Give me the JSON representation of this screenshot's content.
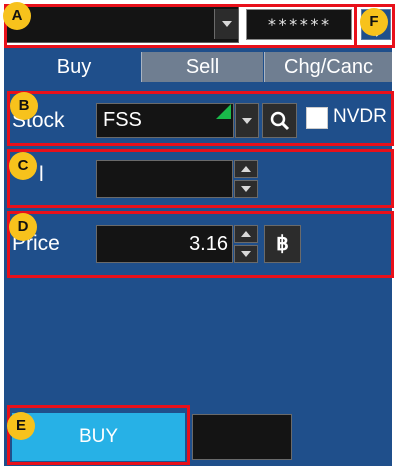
{
  "top_bar": {
    "password_mask": "******"
  },
  "tabs": [
    {
      "label": "Buy"
    },
    {
      "label": "Sell"
    },
    {
      "label": "Chg/Canc"
    }
  ],
  "form": {
    "stock_label": "Stock",
    "stock_value": "FSS",
    "nvdr_label": "NVDR",
    "volume_label_visible": "l",
    "volume_value": "",
    "price_label": "Price",
    "price_value": "3.16",
    "price_icon_glyph": "฿"
  },
  "actions": {
    "buy_label": "BUY"
  },
  "annotations": {
    "badges": [
      "A",
      "B",
      "C",
      "D",
      "E",
      "F"
    ]
  },
  "colors": {
    "panel": "#1f4f8b",
    "buy_button": "#27b1e6",
    "annotation_frame": "#e8101a",
    "badge": "#f7c21c",
    "stock_flag": "#19b94a"
  }
}
